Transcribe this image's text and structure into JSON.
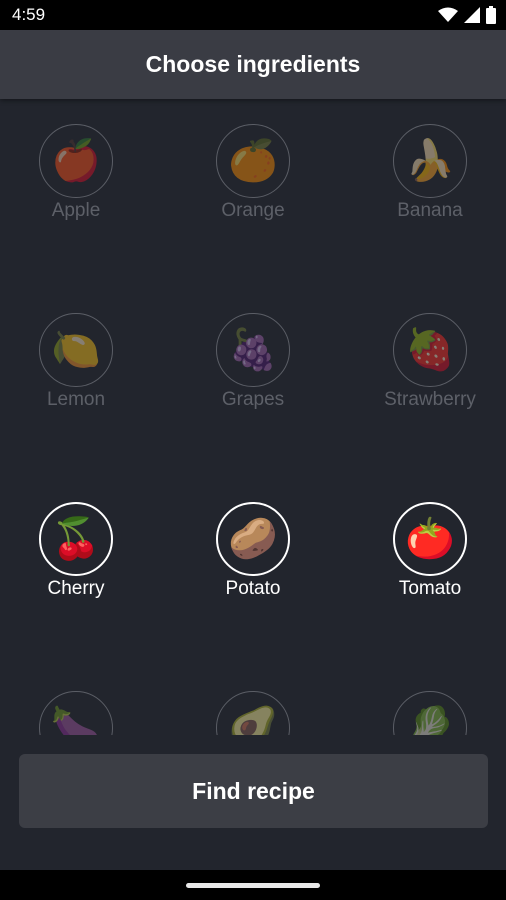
{
  "status_bar": {
    "time": "4:59",
    "icons": [
      "wifi-icon",
      "cellular-signal-icon",
      "battery-icon"
    ]
  },
  "app_bar": {
    "title": "Choose ingredients"
  },
  "ingredients": [
    {
      "label": "Apple",
      "emoji": "🍎",
      "selected": false
    },
    {
      "label": "Orange",
      "emoji": "🍊",
      "selected": false
    },
    {
      "label": "Banana",
      "emoji": "🍌",
      "selected": false
    },
    {
      "label": "Lemon",
      "emoji": "🍋",
      "selected": false
    },
    {
      "label": "Grapes",
      "emoji": "🍇",
      "selected": false
    },
    {
      "label": "Strawberry",
      "emoji": "🍓",
      "selected": false
    },
    {
      "label": "Cherry",
      "emoji": "🍒",
      "selected": true
    },
    {
      "label": "Potato",
      "emoji": "🥔",
      "selected": true
    },
    {
      "label": "Tomato",
      "emoji": "🍅",
      "selected": true
    },
    {
      "label": "",
      "emoji": "🍆",
      "selected": false
    },
    {
      "label": "",
      "emoji": "🥑",
      "selected": false
    },
    {
      "label": "",
      "emoji": "🥬",
      "selected": false
    }
  ],
  "actions": {
    "find_recipe_label": "Find recipe"
  },
  "colors": {
    "background": "#22252d",
    "app_bar": "#3a3c44",
    "button": "#3c3e45",
    "selected_border": "#ffffff",
    "unselected_label": "#5d6068"
  }
}
